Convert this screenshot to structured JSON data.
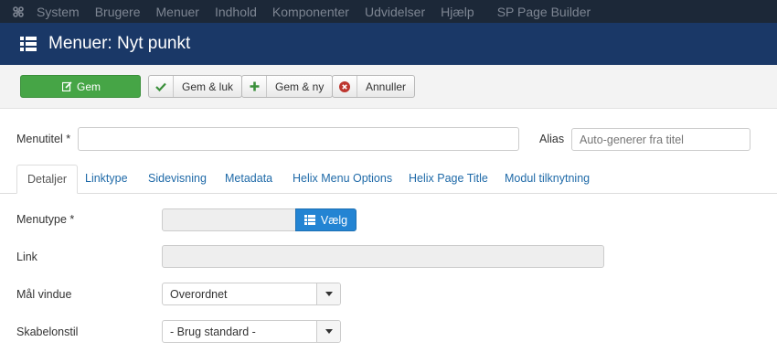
{
  "topnav": {
    "items": [
      "System",
      "Brugere",
      "Menuer",
      "Indhold",
      "Komponenter",
      "Udvidelser",
      "Hjælp"
    ],
    "extra": "SP Page Builder"
  },
  "titlebar": {
    "title": "Menuer: Nyt punkt"
  },
  "toolbar": {
    "save": "Gem",
    "save_close": "Gem & luk",
    "save_new": "Gem & ny",
    "cancel": "Annuller"
  },
  "form": {
    "title_label": "Menutitel *",
    "title_value": "",
    "alias_label": "Alias",
    "alias_placeholder": "Auto-generer fra titel"
  },
  "tabs": [
    "Detaljer",
    "Linktype",
    "Sidevisning",
    "Metadata",
    "Helix Menu Options",
    "Helix Page Title",
    "Modul tilknytning"
  ],
  "details": {
    "menutype_label": "Menutype *",
    "select_button": "Vælg",
    "link_label": "Link",
    "target_label": "Mål vindue",
    "target_value": "Overordnet",
    "template_label": "Skabelonstil",
    "template_value": "- Brug standard -"
  },
  "colors": {
    "topnav_bg": "#1c2838",
    "titlebar_bg": "#1a3867",
    "save_green": "#46a546",
    "select_blue": "#2384d3",
    "link_blue": "#1f6aa8"
  }
}
